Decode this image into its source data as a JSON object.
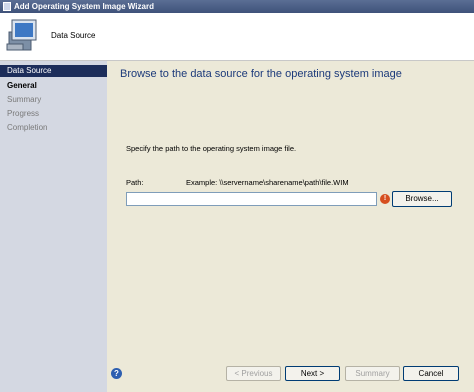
{
  "titlebar": {
    "title": "Add Operating System Image Wizard"
  },
  "header": {
    "title": "Data Source",
    "icon": "computer-monitor-icon"
  },
  "nav": {
    "items": [
      {
        "label": "Data Source",
        "state": "active"
      },
      {
        "label": "General",
        "state": "current"
      },
      {
        "label": "Summary",
        "state": "inactive"
      },
      {
        "label": "Progress",
        "state": "inactive"
      },
      {
        "label": "Completion",
        "state": "inactive"
      }
    ]
  },
  "content": {
    "heading": "Browse to the data source for the operating system image",
    "instruction": "Specify the path to the operating system image file.",
    "path_label": "Path:",
    "path_example": "Example: \\\\servername\\sharename\\path\\file.WIM",
    "path_value": "",
    "browse_label": "Browse..."
  },
  "footer": {
    "prev_label": "< Previous",
    "next_label": "Next >",
    "summary_label": "Summary",
    "cancel_label": "Cancel"
  },
  "colors": {
    "accent": "#1c2d5a",
    "heading": "#1c3a7a",
    "error": "#d64e1f"
  }
}
